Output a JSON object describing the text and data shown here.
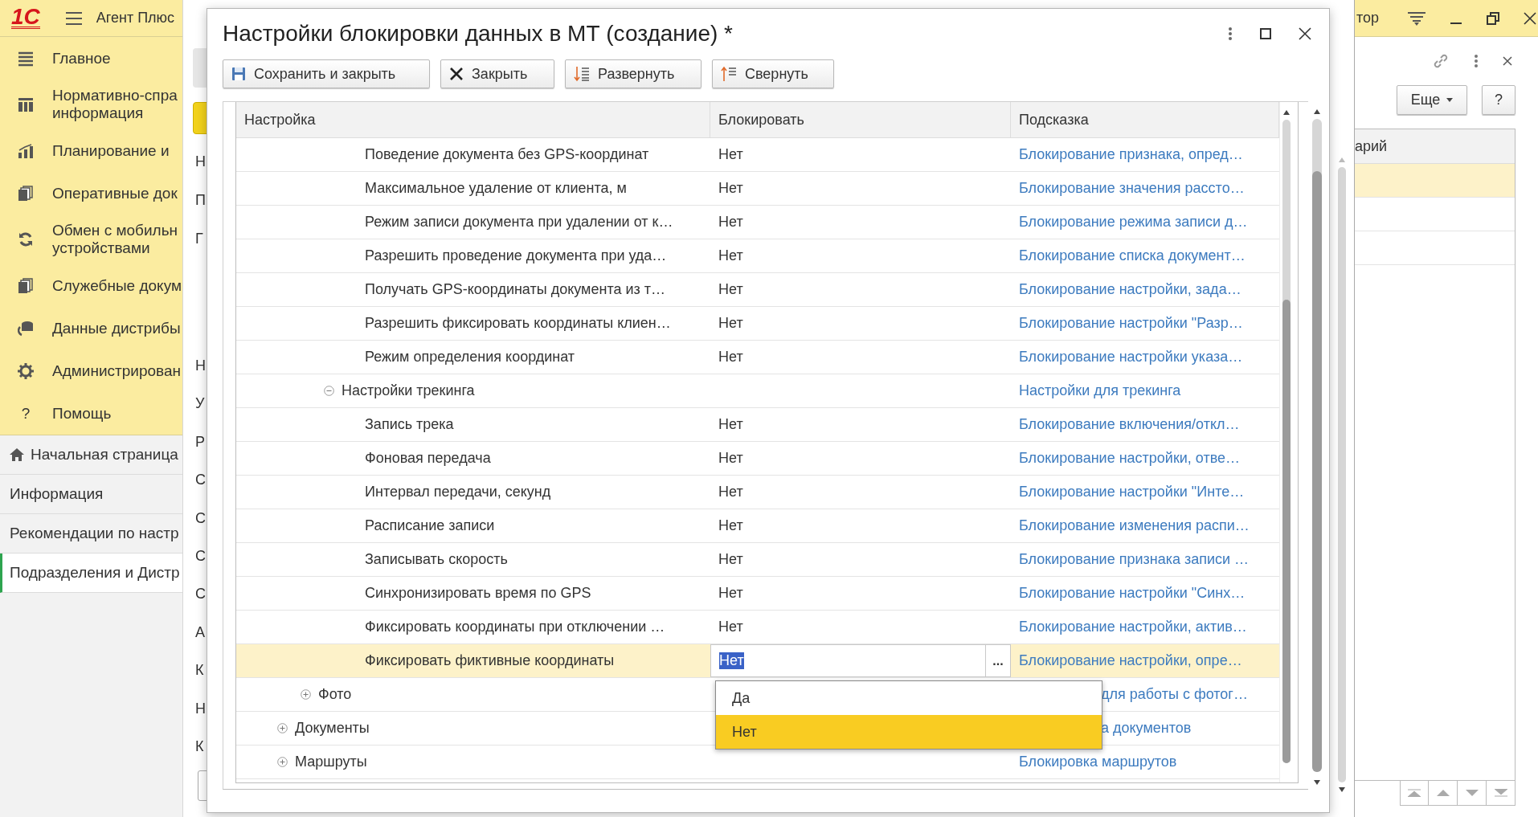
{
  "app_header": {
    "logo": "1С",
    "title": "Агент Плюс"
  },
  "sidebar": {
    "sections": [
      {
        "lines": [
          "Главное"
        ]
      },
      {
        "lines": [
          "Нормативно-спра",
          "информация"
        ]
      },
      {
        "lines": [
          "Планирование и"
        ]
      },
      {
        "lines": [
          "Оперативные док"
        ]
      },
      {
        "lines": [
          "Обмен с мобильн",
          "устройствами"
        ]
      },
      {
        "lines": [
          "Служебные докум"
        ]
      },
      {
        "lines": [
          "Данные дистрибы"
        ]
      },
      {
        "lines": [
          "Администрирован"
        ]
      },
      {
        "lines": [
          "Помощь"
        ],
        "glyph": "?"
      }
    ],
    "open_pages": [
      {
        "label": "Начальная страница",
        "kind": "home",
        "selected": false
      },
      {
        "label": "Информация",
        "kind": "page",
        "selected": false
      },
      {
        "label": "Рекомендации по настр",
        "kind": "page",
        "selected": false
      },
      {
        "label": "Подразделения и Дистр",
        "kind": "page",
        "selected": true
      }
    ]
  },
  "background_form": {
    "labels": [
      "Н",
      "П",
      "Г",
      "Н",
      "У",
      "Р",
      "С",
      "С",
      "С",
      "С",
      "А",
      "К",
      "Н",
      "К"
    ]
  },
  "dialog": {
    "title": "Настройки блокировки данных в МТ (создание) *",
    "buttons": [
      {
        "label": "Сохранить и закрыть"
      },
      {
        "label": "Закрыть"
      },
      {
        "label": "Развернуть"
      },
      {
        "label": "Свернуть"
      }
    ],
    "table": {
      "columns": [
        "Настройка",
        "Блокировать",
        "Подсказка"
      ],
      "edit_button": "...",
      "rows": [
        {
          "children": [
            {
              "children": [
                {
                  "children": [
                    {
                      "label": "Поведение документа без GPS-координат",
                      "value": "Нет",
                      "hint": "Блокирование признака, опред…",
                      "selected": false
                    },
                    {
                      "label": "Максимальное удаление от клиента, м",
                      "value": "Нет",
                      "hint": "Блокирование значения рассто…",
                      "selected": false
                    },
                    {
                      "label": "Режим записи документа при удалении от к…",
                      "value": "Нет",
                      "hint": "Блокирование режима записи д…",
                      "selected": false
                    },
                    {
                      "label": "Разрешить проведение документа при уда…",
                      "value": "Нет",
                      "hint": "Блокирование списка документ…",
                      "selected": false
                    },
                    {
                      "label": "Получать GPS-координаты документа из т…",
                      "value": "Нет",
                      "hint": "Блокирование настройки, зада…",
                      "selected": false
                    },
                    {
                      "label": "Разрешить фиксировать координаты клиен…",
                      "value": "Нет",
                      "hint": "Блокирование настройки \"Разр…",
                      "selected": false
                    },
                    {
                      "label": "Режим определения координат",
                      "value": "Нет",
                      "hint": "Блокирование настройки указа…",
                      "selected": false
                    }
                  ]
                },
                {
                  "label": "Настройки трекинга",
                  "hint": "Настройки для трекинга",
                  "selected": false,
                  "expanded": true,
                  "children": [
                    {
                      "label": "Запись трека",
                      "value": "Нет",
                      "hint": "Блокирование включения/откл…",
                      "selected": false
                    },
                    {
                      "label": "Фоновая передача",
                      "value": "Нет",
                      "hint": "Блокирование настройки, отве…",
                      "selected": false
                    },
                    {
                      "label": "Интервал передачи, секунд",
                      "value": "Нет",
                      "hint": "Блокирование настройки \"Инте…",
                      "selected": false
                    },
                    {
                      "label": "Расписание записи",
                      "value": "Нет",
                      "hint": "Блокирование изменения распи…",
                      "selected": false
                    },
                    {
                      "label": "Записывать скорость",
                      "value": "Нет",
                      "hint": "Блокирование признака записи …",
                      "selected": false
                    },
                    {
                      "label": "Синхронизировать время по GPS",
                      "value": "Нет",
                      "hint": "Блокирование настройки \"Синх…",
                      "selected": false
                    },
                    {
                      "label": "Фиксировать координаты при отключении …",
                      "value": "Нет",
                      "hint": "Блокирование настройки, актив…",
                      "selected": false
                    },
                    {
                      "label": "Фиксировать фиктивные координаты",
                      "value": "Нет",
                      "hint": "Блокирование настройки, опре…",
                      "selected": true
                    }
                  ]
                }
              ]
            },
            {
              "label": "Фото",
              "hint": "для работы с фотог…",
              "selected": false,
              "expanded": false
            }
          ]
        },
        {
          "label": "Документы",
          "hint": "а документов",
          "selected": false,
          "expanded": false
        },
        {
          "label": "Маршруты",
          "hint": "Блокировка маршрутов",
          "selected": false,
          "expanded": false
        }
      ]
    },
    "dropdown": {
      "options": [
        {
          "label": "Да",
          "selected": false
        },
        {
          "label": "Нет",
          "selected": true
        }
      ]
    }
  },
  "right_panel": {
    "window_title": "тор",
    "more_button": "Еще",
    "help_button": "?",
    "table": {
      "columns": [
        "арий"
      ],
      "rows": [
        {
          "selected": true
        },
        {
          "selected": false
        },
        {
          "selected": false
        }
      ]
    }
  }
}
